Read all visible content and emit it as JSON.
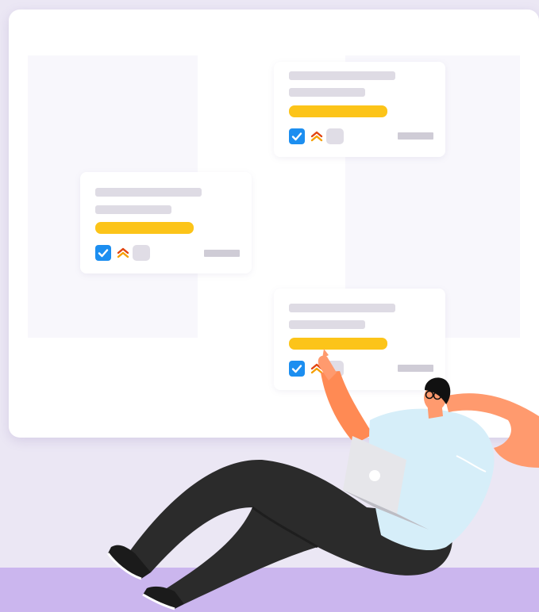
{
  "scene": {
    "description_alt": "",
    "colors": {
      "background": "#ebe7f4",
      "floor": "#cbb6ee",
      "board": "#ffffff",
      "checkbox": "#1c8ef0",
      "highlight_bar": "#fcc419",
      "priority_arrow": "#e2440f",
      "skin": "#ff9a6e",
      "shirt": "#d6eef9",
      "pants": "#2b2b2b"
    },
    "icons": [
      "checkbox-checked-icon",
      "priority-high-icon",
      "laptop-icon"
    ]
  },
  "cards": [
    {
      "checked": true,
      "priority": "high"
    },
    {
      "checked": true,
      "priority": "high"
    },
    {
      "checked": true,
      "priority": "high"
    }
  ]
}
